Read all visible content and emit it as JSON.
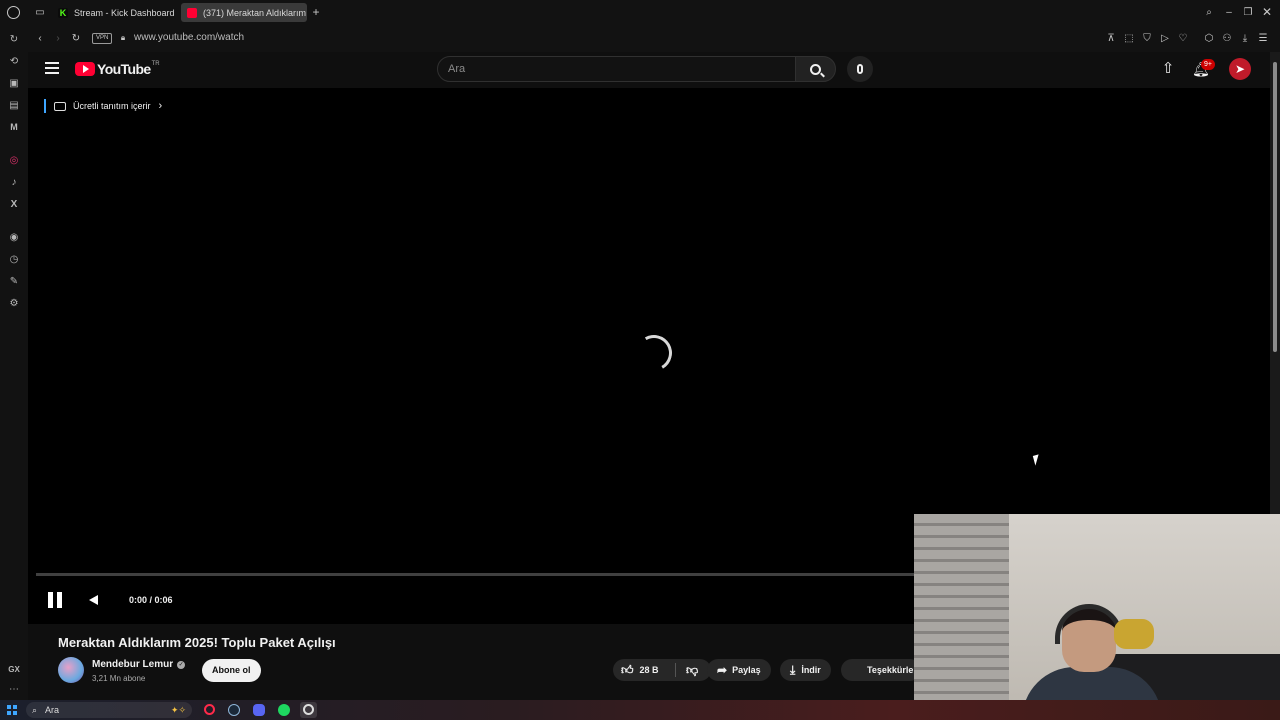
{
  "browser": {
    "tabs": [
      {
        "label": "Stream - Kick Dashboard",
        "favicon_color": "#53fc18",
        "active": false
      },
      {
        "label": "(371) Meraktan Aldıklarım",
        "favicon_color": "#ff0033",
        "active": true
      }
    ],
    "vpn_badge": "VPN",
    "url": "www.youtube.com/watch",
    "sidebar_label_gx": "GX"
  },
  "youtube": {
    "logo_text": "YouTube",
    "logo_region": "TR",
    "search_placeholder": "Ara",
    "notification_count": "9+",
    "promo_label": "Ücretli tanıtım içerir",
    "player": {
      "time": "0:00 / 0:06",
      "state": "loading"
    },
    "video_title": "Meraktan Aldıklarım 2025! Toplu Paket Açılışı",
    "channel_name": "Mendebur Lemur",
    "subscribers": "3,21 Mn abone",
    "subscribe_label": "Abone ol",
    "like_count": "28 B",
    "share_label": "Paylaş",
    "download_label": "İndir",
    "thanks_label": "Teşekkürler"
  },
  "taskbar": {
    "search_placeholder": "Ara"
  },
  "colors": {
    "youtube_red": "#ff0033",
    "background": "#0f0f0f",
    "accent_blue": "#3ea6ff"
  }
}
